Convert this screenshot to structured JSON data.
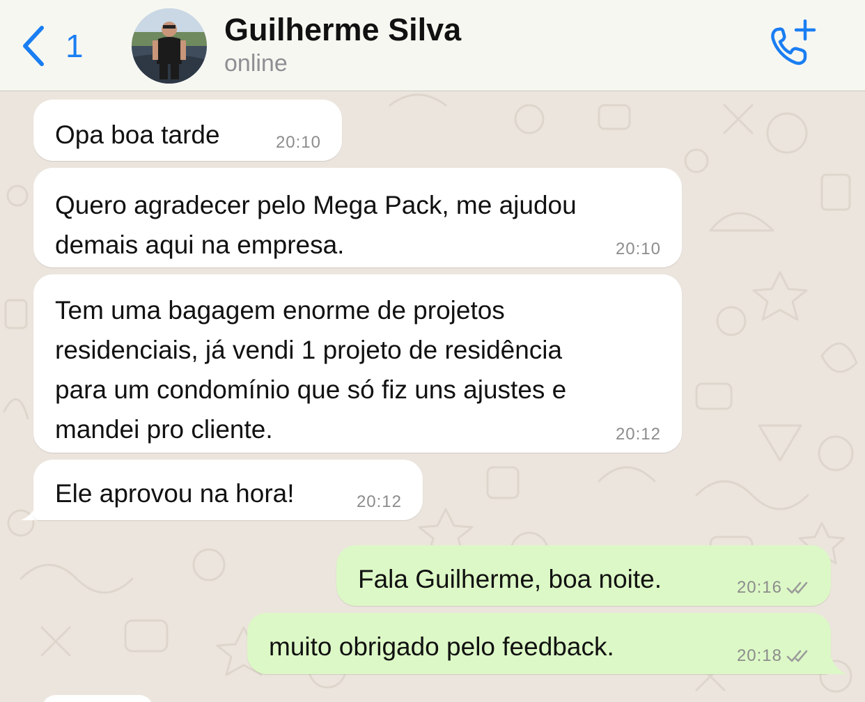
{
  "header": {
    "back_count": "1",
    "contact_name": "Guilherme Silva",
    "contact_status": "online",
    "back_icon": "chevron-left-icon",
    "call_icon": "add-call-icon"
  },
  "colors": {
    "accent": "#1A7EF2",
    "incoming_bubble": "#FFFFFF",
    "outgoing_bubble": "#DCF8C6",
    "chat_background": "#ECE5DD",
    "header_background": "#F7F7F2"
  },
  "messages": [
    {
      "direction": "incoming",
      "text": "Opa boa tarde",
      "time": "20:10"
    },
    {
      "direction": "incoming",
      "text": "Quero agradecer pelo Mega Pack, me ajudou\ndemais aqui na empresa.",
      "time": "20:10"
    },
    {
      "direction": "incoming",
      "text": "Tem uma bagagem enorme de projetos\nresidenciais, já vendi 1 projeto de residência\npara um condomínio que só fiz uns ajustes e\nmandei pro cliente.",
      "time": "20:12"
    },
    {
      "direction": "incoming",
      "text": "Ele aprovou na hora!",
      "time": "20:12"
    },
    {
      "direction": "outgoing",
      "text": "Fala Guilherme, boa noite.",
      "time": "20:16",
      "status_icon": "double-check-icon"
    },
    {
      "direction": "outgoing",
      "text": "muito obrigado pelo feedback.",
      "time": "20:18",
      "status_icon": "double-check-icon"
    }
  ]
}
